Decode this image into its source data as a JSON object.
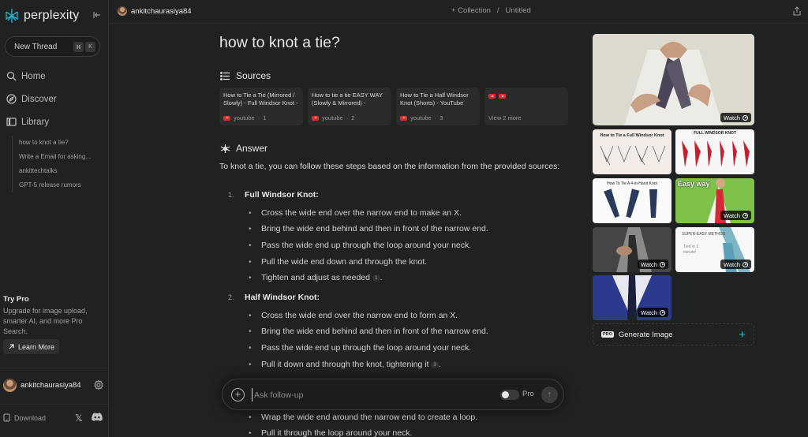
{
  "app": {
    "name": "perplexity"
  },
  "sidebar": {
    "new_thread": "New Thread",
    "shortcut": [
      "⌘",
      "K"
    ],
    "nav": [
      {
        "label": "Home",
        "icon": "search-icon"
      },
      {
        "label": "Discover",
        "icon": "compass-icon"
      },
      {
        "label": "Library",
        "icon": "library-icon"
      }
    ],
    "library_items": [
      "how to knot a tie?",
      "Write a Email for asking...",
      "ankittechtalks",
      "GPT-5 release rumors"
    ],
    "try_pro": {
      "title": "Try Pro",
      "description": "Upgrade for image upload, smarter AI, and more Pro Search.",
      "button": "Learn More"
    },
    "username": "ankitchaurasiya84",
    "download": "Download"
  },
  "header": {
    "username": "ankitchaurasiya84",
    "collection": "+ Collection",
    "separator": "/",
    "title": "Untitled"
  },
  "thread": {
    "question": "how to knot a tie?",
    "sources_label": "Sources",
    "sources": [
      {
        "title": "How to Tie a Tie (Mirrored / Slowly) - Full Windsor Knot - How to Tie a Tie",
        "site": "youtube",
        "index": "1"
      },
      {
        "title": "How to tie a tie EASY WAY (Slowly & Mirrored) - Windsor Knot - How to Tie",
        "site": "youtube",
        "index": "2"
      },
      {
        "title": "How to Tie a Half Windsor Knot (Shorts) - YouTube",
        "site": "youtube",
        "index": "3"
      }
    ],
    "view_more": "View 2 more",
    "answer_label": "Answer",
    "answer_intro": "To knot a tie, you can follow these steps based on the information from the provided sources:",
    "steps": [
      {
        "num": "1.",
        "title": "Full Windsor Knot:",
        "bullets": [
          "Cross the wide end over the narrow end to make an X.",
          "Bring the wide end behind and then in front of the narrow end.",
          "Pass the wide end up through the loop around your neck.",
          "Pull the wide end down and through the knot.",
          "Tighten and adjust as needed"
        ],
        "cite": "1"
      },
      {
        "num": "2.",
        "title": "Half Windsor Knot:",
        "bullets": [
          "Cross the wide end over the narrow end to form an X.",
          "Bring the wide end behind and then in front of the narrow end.",
          "Pass the wide end up through the loop around your neck.",
          "Pull it down and through the knot, tightening it"
        ],
        "cite": "3"
      }
    ],
    "trailing_bullets": [
      "Wrap the wide end around the narrow end to create a loop.",
      "Pull it through the loop around your neck."
    ]
  },
  "followup": {
    "placeholder": "Ask follow-up",
    "pro_label": "Pro"
  },
  "media": {
    "watch_label": "Watch",
    "thumb_texts": [
      "How to Tie a Full Windsor Knot",
      "FULL WINDSOR KNOT",
      "How To Tie A 4-in-Hand Knot",
      "Easy way",
      "SUPER-EASY METHOD",
      "Tied in 1 minute!"
    ],
    "generate_image": "Generate Image",
    "pro_badge": "PRO"
  },
  "colors": {
    "background": "#202222",
    "accent": "#20b8cd",
    "youtube": "#e52d27"
  }
}
